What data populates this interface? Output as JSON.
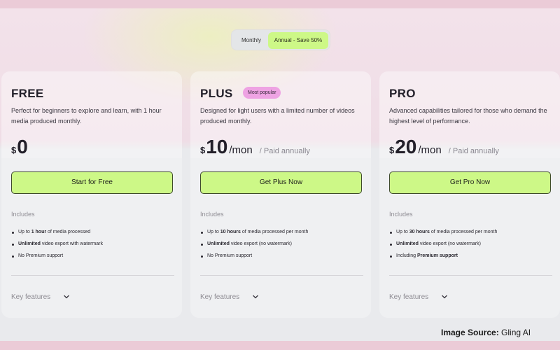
{
  "billing_toggle": {
    "monthly_label": "Monthly",
    "annual_label": "Annual - Save 50%",
    "selected": "annual"
  },
  "plans": [
    {
      "name": "FREE",
      "badge": "",
      "description": "Perfect for beginners to explore and learn, with 1 hour media produced monthly.",
      "currency": "$",
      "amount": "0",
      "period": "",
      "billing_note": "",
      "cta_label": "Start for Free",
      "includes_label": "Includes",
      "features": [
        {
          "pre": "Up to ",
          "bold": "1 hour",
          "post": " of media processed"
        },
        {
          "pre": "",
          "bold": "Unlimited",
          "post": " video export with watermark"
        },
        {
          "pre": "No Premium support",
          "bold": "",
          "post": ""
        }
      ],
      "key_features_label": "Key features"
    },
    {
      "name": "PLUS",
      "badge": "Most popular",
      "description": "Designed for light users with a limited number of videos produced monthly.",
      "currency": "$",
      "amount": "10",
      "period": "/mon",
      "billing_note": "/ Paid annually",
      "cta_label": "Get Plus Now",
      "includes_label": "Includes",
      "features": [
        {
          "pre": "Up to ",
          "bold": "10 hours",
          "post": " of media processed per month"
        },
        {
          "pre": "",
          "bold": "Unlimited",
          "post": " video export (no watermark)"
        },
        {
          "pre": "No Premium support",
          "bold": "",
          "post": ""
        }
      ],
      "key_features_label": "Key features"
    },
    {
      "name": "PRO",
      "badge": "",
      "description": "Advanced capabilities tailored for those who demand the highest level of performance.",
      "currency": "$",
      "amount": "20",
      "period": "/mon",
      "billing_note": "/ Paid annually",
      "cta_label": "Get Pro Now",
      "includes_label": "Includes",
      "features": [
        {
          "pre": "Up to ",
          "bold": "30 hours",
          "post": " of media processed per month"
        },
        {
          "pre": "",
          "bold": "Unlimited",
          "post": " video export (no watermark)"
        },
        {
          "pre": "Including ",
          "bold": "Premium support",
          "post": ""
        }
      ],
      "key_features_label": "Key features"
    }
  ],
  "source_credit": {
    "label": "Image Source:",
    "value": "Gling AI"
  },
  "colors": {
    "accent_lime": "#cdf887",
    "badge_pink": "#eea3e3",
    "text_dark": "#23202a",
    "text_muted": "#8f8d94"
  }
}
